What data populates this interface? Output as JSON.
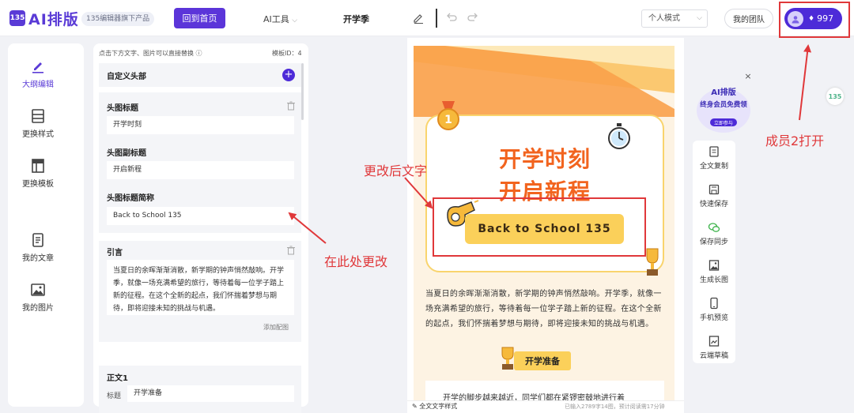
{
  "header": {
    "logo_icon": "135",
    "logo_text": "AI排版",
    "logo_badge": "135编辑器旗下产品",
    "home_button": "回到首页",
    "ai_tools": "AI工具",
    "doc_title": "开学季",
    "mode_select": "个人模式",
    "team_button": "我的团队",
    "vip_points": "997"
  },
  "leftnav": {
    "items": [
      {
        "label": "大纲编辑"
      },
      {
        "label": "更换样式"
      },
      {
        "label": "更换模板"
      },
      {
        "label": "我的文章"
      },
      {
        "label": "我的图片"
      }
    ]
  },
  "editor": {
    "hint": "点击下方文字、图片可以直接替换",
    "template_id": "模板ID：4",
    "custom_header": "自定义头部",
    "head_title_label": "头图标题",
    "head_title_value": "开学时刻",
    "head_subtitle_label": "头图副标题",
    "head_subtitle_value": "开启新程",
    "head_short_label": "头图标题简称",
    "head_short_value": "Back to School 135",
    "quote_label": "引言",
    "quote_value": "当夏日的余晖渐渐消散，新学期的钟声悄然敲响。开学季，就像一场充满希望的旅行，等待着每一位学子踏上新的征程。在这个全新的起点，我们怀揣着梦想与期待，即将迎接未知的挑战与机遇。",
    "add_image": "添加配图",
    "body_label": "正文1",
    "body_row_label": "标题",
    "body_row_value": "开学准备"
  },
  "preview": {
    "title_line1": "开学时刻",
    "title_line2": "开启新程",
    "pill_text": "Back to School 135",
    "medal_number": "1",
    "paragraph": "当夏日的余晖渐渐消散，新学期的钟声悄然敲响。开学季，就像一场充满希望的旅行，等待着每一位学子踏上新的征程。在这个全新的起点，我们怀揣着梦想与期待，即将迎接未知的挑战与机遇。",
    "section_title": "开学准备",
    "paragraph2": "开学的脚步越来越近，同学们都在紧锣密鼓地进行着",
    "footer_left": "全文文字样式",
    "footer_right": "已输入2789字14图，预计阅读需17分钟"
  },
  "promo": {
    "line1": "AI排版",
    "line2": "终身会员免费领",
    "button": "立即参与"
  },
  "tools": {
    "items": [
      {
        "label": "全文复制"
      },
      {
        "label": "快速保存"
      },
      {
        "label": "保存同步"
      },
      {
        "label": "生成长图"
      },
      {
        "label": "手机预览"
      },
      {
        "label": "云端草稿"
      }
    ],
    "side_logo": "135"
  },
  "annotations": {
    "changed_text": "更改后文字",
    "change_here": "在此处更改",
    "member_open": "成员2打开"
  },
  "colors": {
    "brand": "#5a3bd6",
    "annotation": "#e0383a",
    "preview_orange": "#f2641f",
    "preview_yellow": "#fbd05a"
  }
}
